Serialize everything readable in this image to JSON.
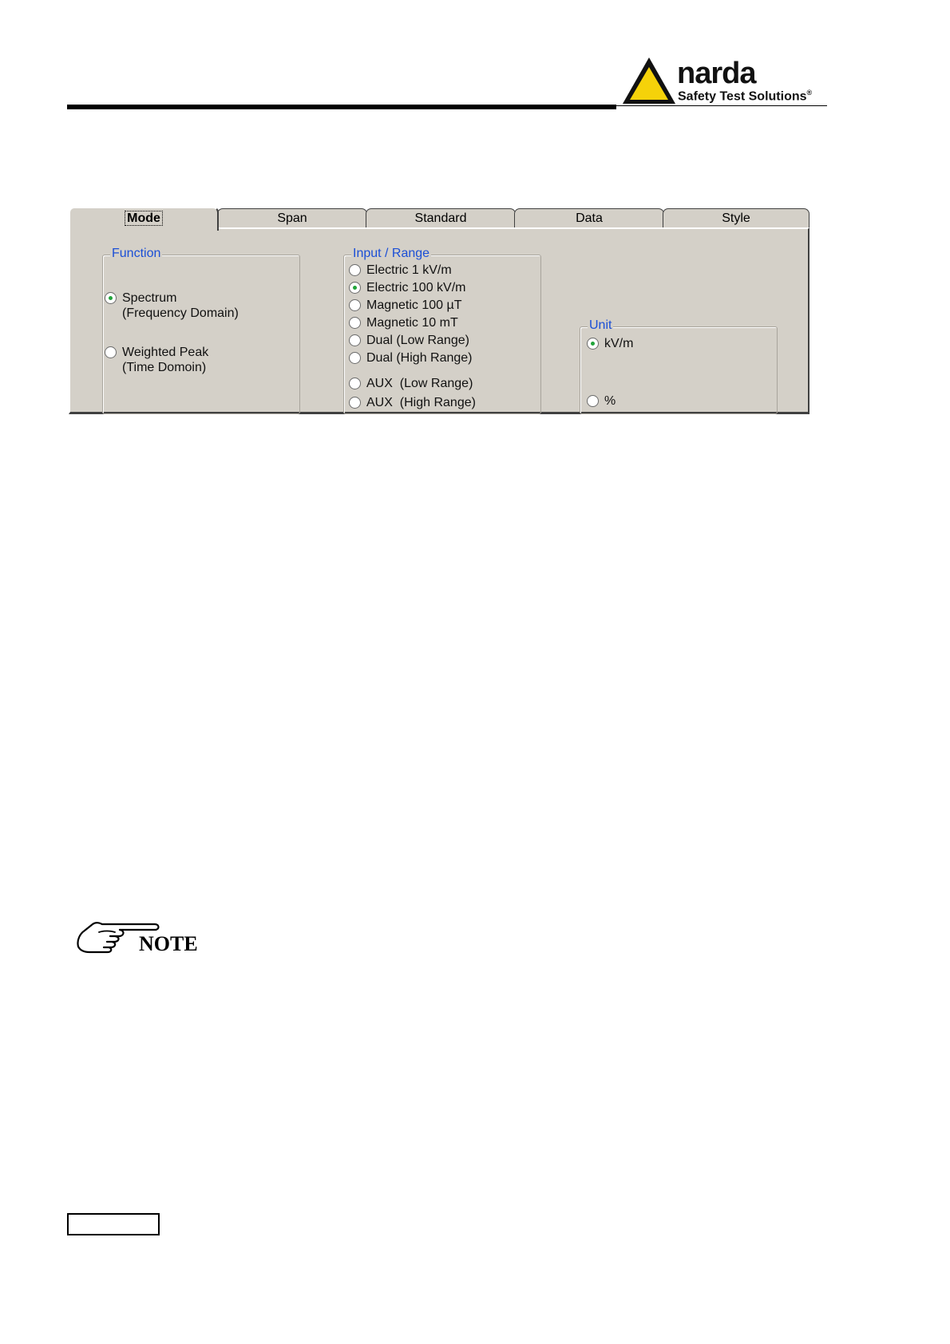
{
  "header": {
    "brand": "narda",
    "tagline": "Safety Test Solutions",
    "registered": "®"
  },
  "dialog": {
    "tabs": [
      "Mode",
      "Span",
      "Standard",
      "Data",
      "Style"
    ],
    "active_tab": "Mode",
    "function_group": {
      "title": "Function",
      "options": [
        {
          "line1": "Spectrum",
          "line2": "(Frequency Domain)",
          "selected": true
        },
        {
          "line1": "Weighted Peak",
          "line2": "(Time Domoin)",
          "selected": false
        }
      ]
    },
    "input_group": {
      "title": "Input / Range",
      "options": [
        {
          "label": "Electric 1 kV/m",
          "selected": false
        },
        {
          "label": "Electric 100 kV/m",
          "selected": true
        },
        {
          "label": "Magnetic 100 µT",
          "selected": false
        },
        {
          "label": "Magnetic 10 mT",
          "selected": false
        },
        {
          "label": "Dual (Low Range)",
          "selected": false
        },
        {
          "label": "Dual (High Range)",
          "selected": false
        },
        {
          "label": "AUX  (Low Range)",
          "selected": false
        },
        {
          "label": "AUX  (High Range)",
          "selected": false
        }
      ]
    },
    "unit_group": {
      "title": "Unit",
      "options": [
        {
          "label": "kV/m",
          "selected": true
        },
        {
          "label": "%",
          "selected": false
        }
      ]
    }
  },
  "note": {
    "label": "NOTE",
    "icon": "pointing-hand-icon"
  },
  "colors": {
    "panel": "#d4d0c8",
    "group_title": "#1b4fd6",
    "radio_selected": "#22a43a",
    "logo_yellow": "#f5d20a"
  }
}
